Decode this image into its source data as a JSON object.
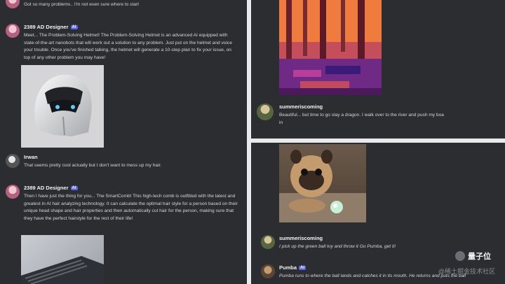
{
  "left_panel": {
    "intro_message": "Got so many problems.. I'm not even sure where to start",
    "messages": [
      {
        "author": "2389 AD Designer",
        "badge": "AI",
        "text": "Meet... The Problem-Solving Helmet! The Problem-Solving Helmet is an advanced AI equipped with state-of-the-art nanobots that will work out a solution to any problem. Just put on the helmet and voice your trouble. Once you've finished talking, the helmet will generate a 10-step plan to fix your issue, on top of any other problem you may have!",
        "image": "helmet-image"
      },
      {
        "author": "Irwan",
        "text": "That seems pretty cool actually but I don't want to mess up my hair."
      },
      {
        "author": "2389 AD Designer",
        "badge": "AI",
        "text": "Then I have just the thing for you... The SmartComb! This high-tech comb is outfitted with the latest and greatest in AI hair analyzing technology. It can calculate the optimal hair style for a person based on their unique head shape and hair properties and then automatically cut hair for the person, making sure that they have the perfect hairstyle for the rest of their life!",
        "image": "comb-image"
      }
    ]
  },
  "right_top_panel": {
    "image": "pixel-forest-image",
    "message": {
      "author": "summeriscoming",
      "text": "Beautiful... but time to go slay a dragon. I walk over to the river and push my boa",
      "text_line2": "in"
    }
  },
  "right_bottom_panel": {
    "image": "pug-ball-image",
    "messages": [
      {
        "author": "summeriscoming",
        "text": "I pick up the green ball toy and throw it Go Pumba, get it!"
      },
      {
        "author": "Pumba",
        "badge": "AI",
        "text": "Pumba runs to where the ball lands and catches it in its mouth. He returns and puts the ball"
      }
    ]
  },
  "watermark": {
    "brand": "量子位",
    "source": "@稀土掘金技术社区"
  }
}
